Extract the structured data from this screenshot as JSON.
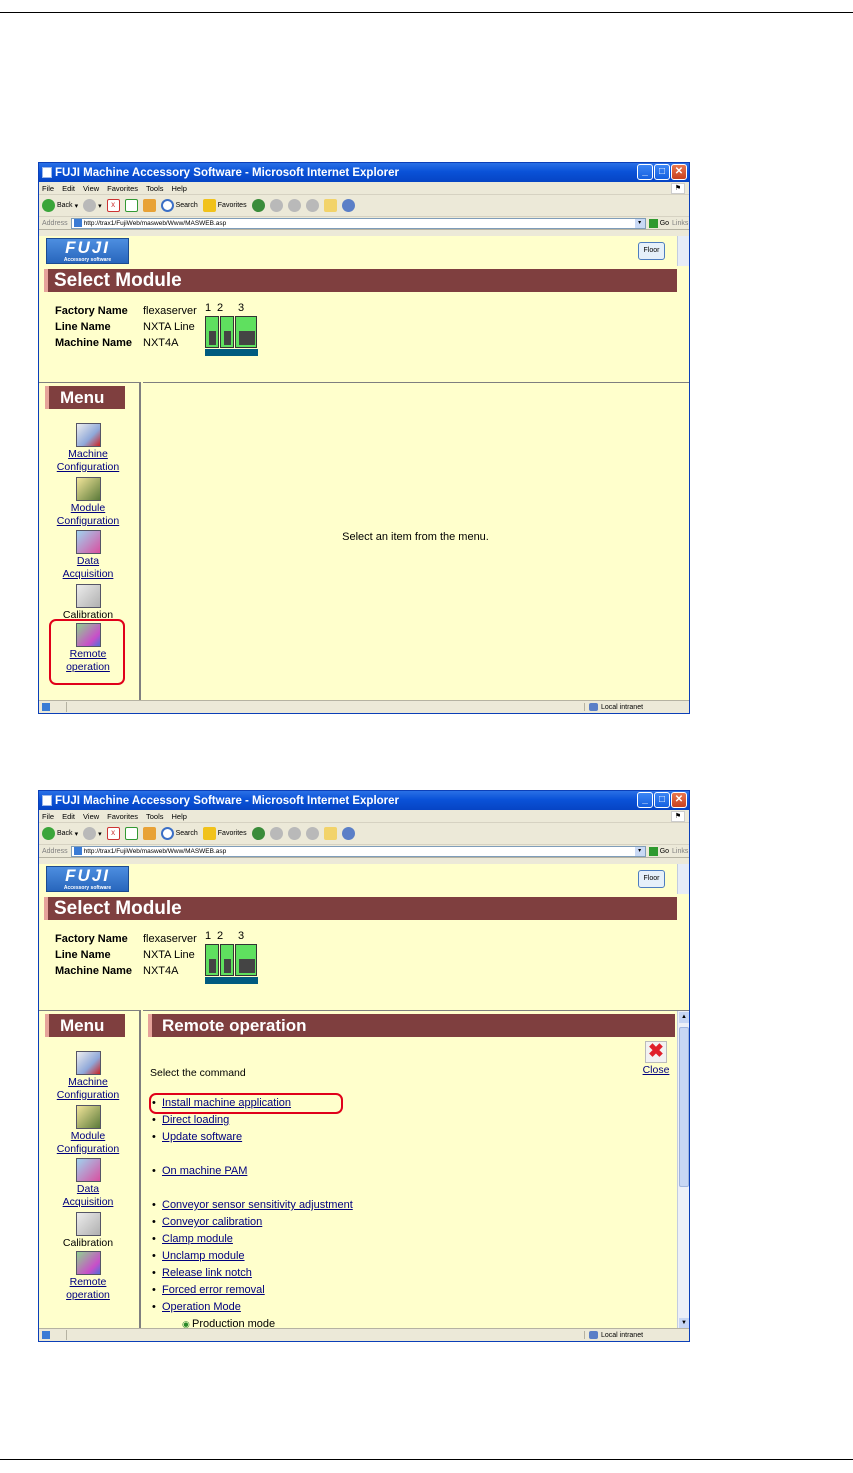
{
  "browser": {
    "title": "FUJI Machine Accessory Software - Microsoft Internet Explorer",
    "menu": [
      "File",
      "Edit",
      "View",
      "Favorites",
      "Tools",
      "Help"
    ],
    "toolbar": {
      "back": "Back",
      "search": "Search",
      "favorites": "Favorites"
    },
    "address_label": "Address",
    "url": "http://trax1/FujiWeb/masweb/Www/MASWEB.asp",
    "go": "Go",
    "links": "Links",
    "status_zone": "Local intranet"
  },
  "header": {
    "logo_main": "FUJI",
    "logo_sub": "Accessory software",
    "floor_button": "Floor",
    "banner": "Select Module"
  },
  "info": {
    "factory_label": "Factory Name",
    "factory_value": "flexaserver",
    "line_label": "Line Name",
    "line_value": "NXTA Line",
    "machine_label": "Machine Name",
    "machine_value": "NXT4A",
    "module_numbers": [
      "1",
      "2",
      "3"
    ]
  },
  "menu": {
    "title": "Menu",
    "items": [
      {
        "line1": "Machine",
        "line2": "Configuration",
        "icon": "machine-configuration-icon"
      },
      {
        "line1": "Module",
        "line2": "Configuration",
        "icon": "module-configuration-icon"
      },
      {
        "line1": "Data",
        "line2": "Acquisition",
        "icon": "data-acquisition-icon"
      },
      {
        "line1": "Calibration",
        "line2": "",
        "icon": "calibration-icon"
      },
      {
        "line1": "Remote",
        "line2": "operation",
        "icon": "remote-operation-icon"
      }
    ]
  },
  "screen1": {
    "placeholder": "Select an item from the menu."
  },
  "screen2": {
    "title": "Remote operation",
    "select_command": "Select the command",
    "close": "Close",
    "commands": [
      "Install machine application",
      "Direct loading",
      "Update software",
      "On machine PAM",
      "Conveyor sensor sensitivity adjustment",
      "Conveyor calibration",
      "Clamp module",
      "Unclamp module",
      "Release link notch",
      "Forced error removal",
      "Operation Mode"
    ],
    "sub_option": "Production mode"
  },
  "colors": {
    "banner": "#7f3f3f",
    "content_bg": "#ffffcc",
    "highlight": "#e0001a",
    "link": "#00007f",
    "xp_title": "#0a52d8"
  }
}
